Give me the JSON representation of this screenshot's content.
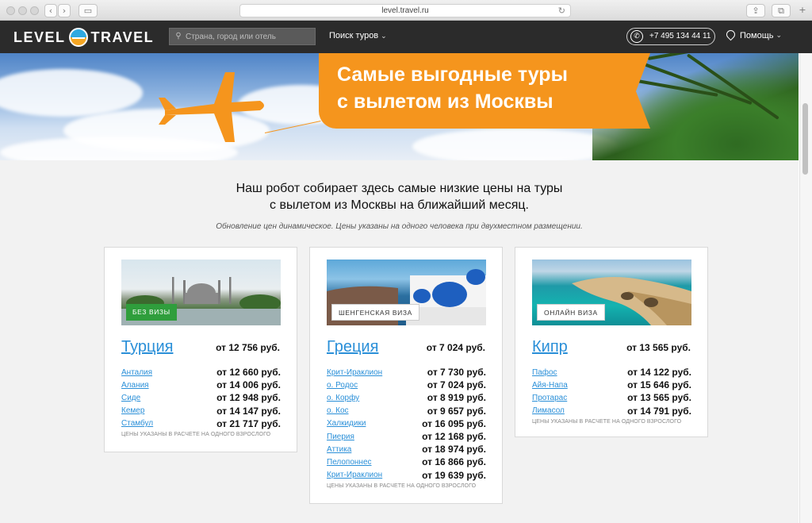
{
  "browser": {
    "url": "level.travel.ru"
  },
  "header": {
    "logo_left": "LEVEL",
    "logo_right": "TRAVEL",
    "search_placeholder": "Страна, город или отель",
    "nav_tours": "Поиск туров",
    "phone": "+7 495 134 44 11",
    "help": "Помощь"
  },
  "banner": {
    "line1": "Самые выгодные туры",
    "line2": "с вылетом из Москвы"
  },
  "intro": {
    "line1": "Наш робот собирает здесь самые низкие цены на туры",
    "line2": "с вылетом из Москвы на ближайший месяц.",
    "note": "Обновление цен динамическое. Цены указаны на одного человека при двухместном размещении."
  },
  "cards": [
    {
      "badge": "БЕЗ ВИЗЫ",
      "country": "Турция",
      "price": "от 12 756 руб.",
      "cities": [
        {
          "name": "Анталия",
          "price": "от 12 660 руб."
        },
        {
          "name": "Алания",
          "price": "от 14 006 руб."
        },
        {
          "name": "Сиде",
          "price": "от 12 948 руб."
        },
        {
          "name": "Кемер",
          "price": "от 14 147 руб."
        },
        {
          "name": "Стамбул",
          "price": "от 21 717 руб."
        }
      ],
      "footnote": "Цены указаны в расчете на одного взрослого"
    },
    {
      "badge": "ШЕНГЕНСКАЯ ВИЗА",
      "country": "Греция",
      "price": "от 7 024 руб.",
      "cities": [
        {
          "name": "Крит-Ираклион",
          "price": "от 7 730 руб."
        },
        {
          "name": "о. Родос",
          "price": "от 7 024 руб."
        },
        {
          "name": "о. Корфу",
          "price": "от 8 919 руб."
        },
        {
          "name": "о. Кос",
          "price": "от 9 657 руб."
        },
        {
          "name": "Халкидики",
          "price": "от 16 095 руб."
        },
        {
          "name": "Пиерия",
          "price": "от 12 168 руб."
        },
        {
          "name": "Аттика",
          "price": "от 18 974 руб."
        },
        {
          "name": "Пелопоннес",
          "price": "от 16 866 руб."
        },
        {
          "name": "Крит-Ираклион",
          "price": "от 19 639 руб."
        }
      ],
      "footnote": "Цены указаны в расчете на одного взрослого"
    },
    {
      "badge": "ОНЛАЙН ВИЗА",
      "country": "Кипр",
      "price": "от 13 565 руб.",
      "cities": [
        {
          "name": "Пафос",
          "price": "от 14 122 руб."
        },
        {
          "name": "Айя-Напа",
          "price": "от 15 646 руб."
        },
        {
          "name": "Протарас",
          "price": "от 13 565 руб."
        },
        {
          "name": "Лимасол",
          "price": "от 14 791 руб."
        }
      ],
      "footnote": "Цены указаны в расчете на одного взрослого"
    }
  ],
  "colors": {
    "accent_orange": "#f5951d",
    "link_blue": "#2a8fd8",
    "badge_green": "#2f9e3c",
    "header_dark": "#2b2b2b"
  }
}
